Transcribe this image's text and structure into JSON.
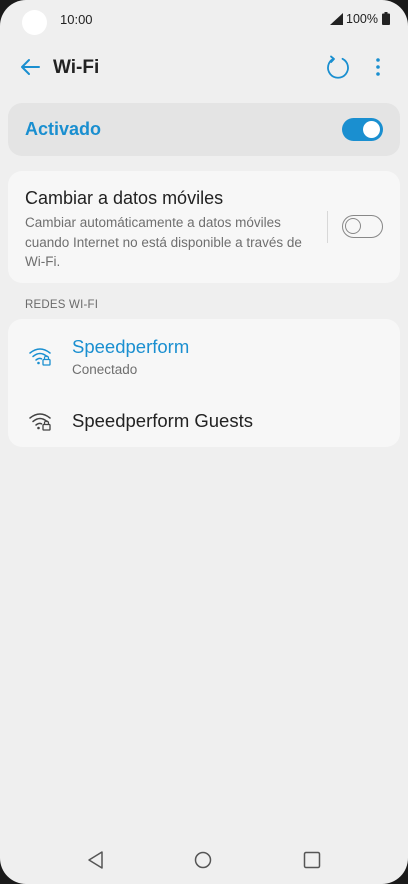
{
  "status_bar": {
    "time": "10:00",
    "battery_percent": "100%",
    "icons": [
      "signal-icon",
      "battery-icon"
    ]
  },
  "header": {
    "title": "Wi-Fi",
    "icons": [
      "back-arrow-icon",
      "refresh-icon",
      "more-options-icon"
    ]
  },
  "master_switch": {
    "label": "Activado",
    "state": "on"
  },
  "mobile_data": {
    "title": "Cambiar a datos móviles",
    "description": "Cambiar automáticamente a datos móviles cuando Internet no está disponible a través de Wi-Fi.",
    "state": "off"
  },
  "networks": {
    "section_title": "REDES WI-FI",
    "items": [
      {
        "name": "Speedperform",
        "status": "Conectado",
        "icon": "wifi-locked-icon"
      },
      {
        "name": "Speedperform Guests",
        "icon": "wifi-locked-icon"
      }
    ]
  },
  "colors": {
    "accent": "#1a8fd0",
    "background": "#efefef",
    "card": "#f7f7f7"
  },
  "nav_bar": {
    "icons": [
      "nav-back-icon",
      "nav-home-icon",
      "nav-recents-icon"
    ]
  }
}
